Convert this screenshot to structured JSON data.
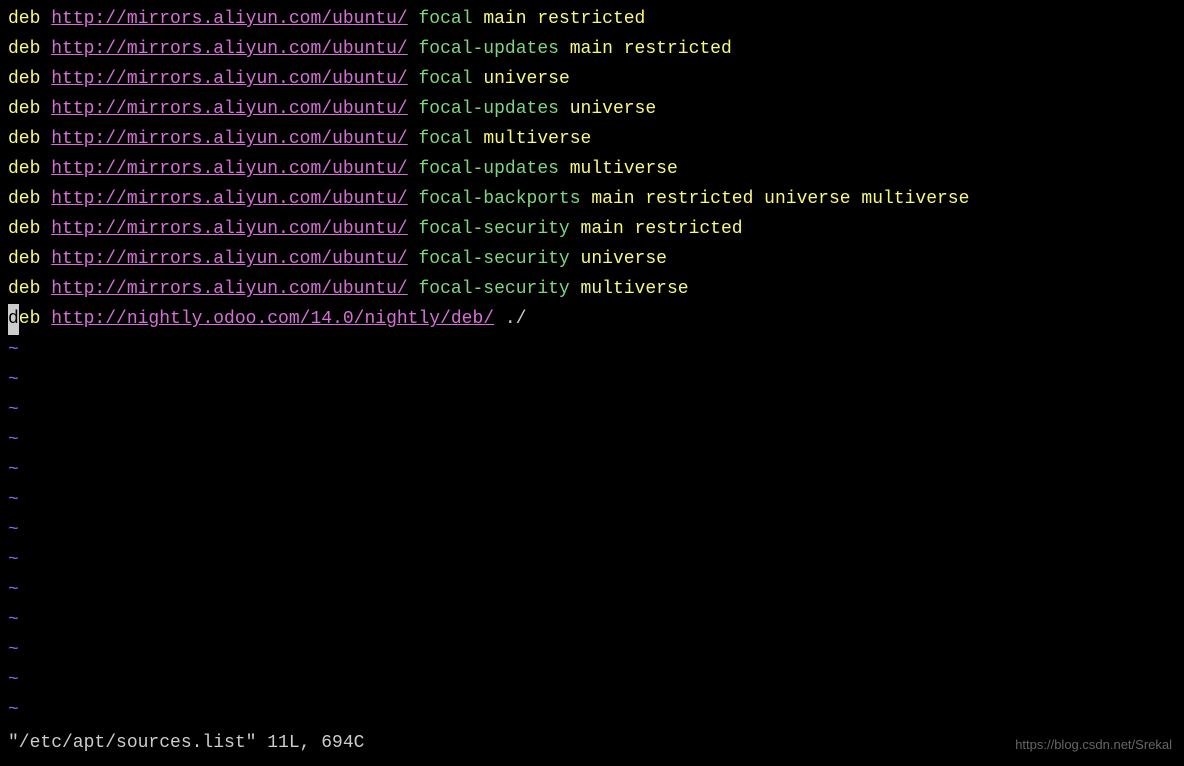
{
  "lines": [
    {
      "kw": "deb",
      "url": "http://mirrors.aliyun.com/ubuntu/",
      "suite": "focal",
      "comps": "main restricted",
      "cursor": false
    },
    {
      "kw": "deb",
      "url": "http://mirrors.aliyun.com/ubuntu/",
      "suite": "focal-updates",
      "comps": "main restricted",
      "cursor": false
    },
    {
      "kw": "deb",
      "url": "http://mirrors.aliyun.com/ubuntu/",
      "suite": "focal",
      "comps": "universe",
      "cursor": false
    },
    {
      "kw": "deb",
      "url": "http://mirrors.aliyun.com/ubuntu/",
      "suite": "focal-updates",
      "comps": "universe",
      "cursor": false
    },
    {
      "kw": "deb",
      "url": "http://mirrors.aliyun.com/ubuntu/",
      "suite": "focal",
      "comps": "multiverse",
      "cursor": false
    },
    {
      "kw": "deb",
      "url": "http://mirrors.aliyun.com/ubuntu/",
      "suite": "focal-updates",
      "comps": "multiverse",
      "cursor": false
    },
    {
      "kw": "deb",
      "url": "http://mirrors.aliyun.com/ubuntu/",
      "suite": "focal-backports",
      "comps": "main restricted universe multiverse",
      "cursor": false
    },
    {
      "kw": "deb",
      "url": "http://mirrors.aliyun.com/ubuntu/",
      "suite": "focal-security",
      "comps": "main restricted",
      "cursor": false
    },
    {
      "kw": "deb",
      "url": "http://mirrors.aliyun.com/ubuntu/",
      "suite": "focal-security",
      "comps": "universe",
      "cursor": false
    },
    {
      "kw": "deb",
      "url": "http://mirrors.aliyun.com/ubuntu/",
      "suite": "focal-security",
      "comps": "multiverse",
      "cursor": false
    },
    {
      "kw": "deb",
      "url": "http://nightly.odoo.com/14.0/nightly/deb/",
      "suite": "./",
      "comps": "",
      "cursor": true,
      "plain_suite": true
    }
  ],
  "tilde_count": 13,
  "tilde": "~",
  "status": "\"/etc/apt/sources.list\" 11L, 694C",
  "watermark": "https://blog.csdn.net/Srekal",
  "colors": {
    "bg": "#000000",
    "keyword": "#f8f87a",
    "url": "#d670d6",
    "suite": "#7fd67f",
    "components": "#f8f87a",
    "tilde": "#7070f0",
    "status": "#cccccc"
  }
}
